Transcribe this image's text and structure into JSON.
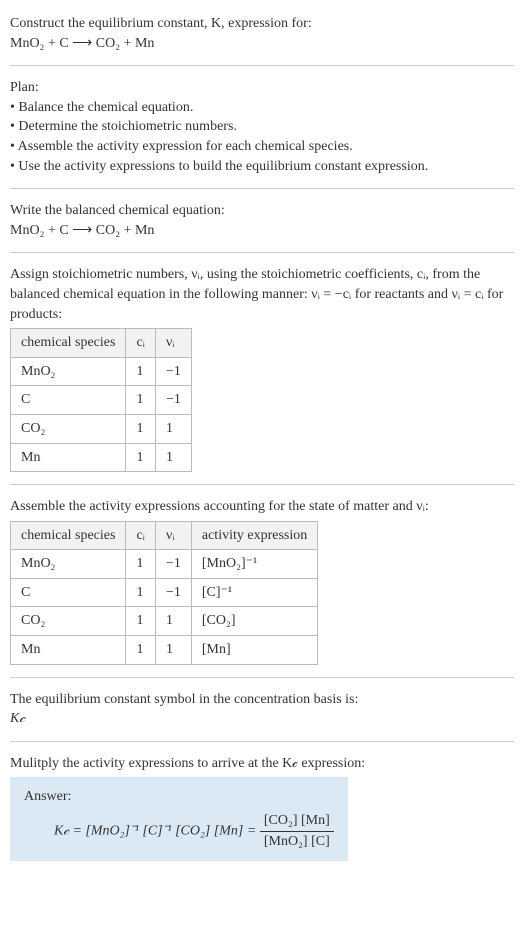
{
  "intro": {
    "line1": "Construct the equilibrium constant, K, expression for:",
    "equation": "MnO₂ + C ⟶ CO₂ + Mn"
  },
  "plan": {
    "heading": "Plan:",
    "b1": "• Balance the chemical equation.",
    "b2": "• Determine the stoichiometric numbers.",
    "b3": "• Assemble the activity expression for each chemical species.",
    "b4": "• Use the activity expressions to build the equilibrium constant expression."
  },
  "balanced": {
    "heading": "Write the balanced chemical equation:",
    "equation": "MnO₂ + C ⟶ CO₂ + Mn"
  },
  "stoich": {
    "text_a": "Assign stoichiometric numbers, νᵢ, using the stoichiometric coefficients, cᵢ, from the balanced chemical equation in the following manner: νᵢ = −cᵢ for reactants and νᵢ = cᵢ for products:",
    "headers": {
      "h1": "chemical species",
      "h2": "cᵢ",
      "h3": "νᵢ"
    },
    "rows": [
      {
        "sp": "MnO₂",
        "c": "1",
        "v": "−1"
      },
      {
        "sp": "C",
        "c": "1",
        "v": "−1"
      },
      {
        "sp": "CO₂",
        "c": "1",
        "v": "1"
      },
      {
        "sp": "Mn",
        "c": "1",
        "v": "1"
      }
    ]
  },
  "activity": {
    "heading": "Assemble the activity expressions accounting for the state of matter and νᵢ:",
    "headers": {
      "h1": "chemical species",
      "h2": "cᵢ",
      "h3": "νᵢ",
      "h4": "activity expression"
    },
    "rows": [
      {
        "sp": "MnO₂",
        "c": "1",
        "v": "−1",
        "a": "[MnO₂]⁻¹"
      },
      {
        "sp": "C",
        "c": "1",
        "v": "−1",
        "a": "[C]⁻¹"
      },
      {
        "sp": "CO₂",
        "c": "1",
        "v": "1",
        "a": "[CO₂]"
      },
      {
        "sp": "Mn",
        "c": "1",
        "v": "1",
        "a": "[Mn]"
      }
    ]
  },
  "symbol": {
    "heading": "The equilibrium constant symbol in the concentration basis is:",
    "value": "K𝒸"
  },
  "final": {
    "heading": "Mulitply the activity expressions to arrive at the K𝒸 expression:",
    "answer_label": "Answer:",
    "lhs": "K𝒸 = [MnO₂]⁻¹ [C]⁻¹ [CO₂] [Mn] = ",
    "num": "[CO₂] [Mn]",
    "den": "[MnO₂] [C]"
  },
  "chart_data": {
    "type": "table",
    "title": "Stoichiometric and activity data for MnO2 + C -> CO2 + Mn",
    "columns": [
      "chemical species",
      "c_i",
      "nu_i",
      "activity expression"
    ],
    "rows": [
      [
        "MnO2",
        1,
        -1,
        "[MnO2]^-1"
      ],
      [
        "C",
        1,
        -1,
        "[C]^-1"
      ],
      [
        "CO2",
        1,
        1,
        "[CO2]"
      ],
      [
        "Mn",
        1,
        1,
        "[Mn]"
      ]
    ]
  }
}
